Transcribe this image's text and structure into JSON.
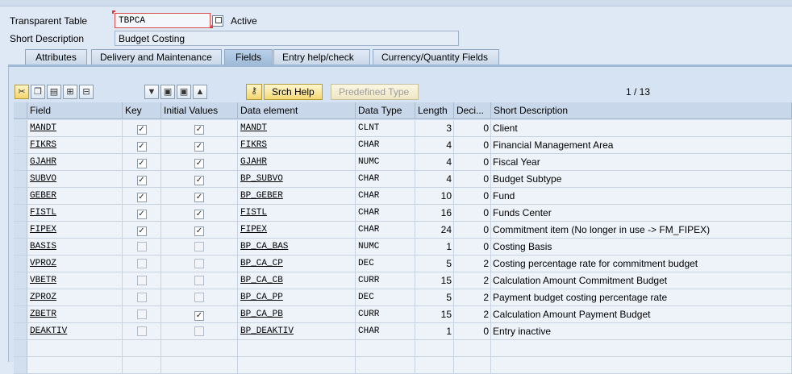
{
  "header": {
    "table_label": "Transparent Table",
    "table_name": "TBPCA",
    "status": "Active",
    "desc_label": "Short Description",
    "description": "Budget Costing"
  },
  "tabs": [
    {
      "label": "Attributes",
      "active": false
    },
    {
      "label": "Delivery and Maintenance",
      "active": false
    },
    {
      "label": "Fields",
      "active": true
    },
    {
      "label": "Entry help/check",
      "active": false
    },
    {
      "label": "Currency/Quantity Fields",
      "active": false
    }
  ],
  "toolbar": {
    "srch_help_label": "Srch Help",
    "predefined_type_label": "Predefined Type",
    "pager": "1 / 13"
  },
  "table": {
    "columns": [
      "Field",
      "Key",
      "Initial Values",
      "Data element",
      "Data Type",
      "Length",
      "Deci...",
      "Short Description"
    ],
    "rows": [
      {
        "field": "MANDT",
        "key": true,
        "initial": true,
        "element": "MANDT",
        "type": "CLNT",
        "length": "3",
        "decimals": "0",
        "desc": "Client"
      },
      {
        "field": "FIKRS",
        "key": true,
        "initial": true,
        "element": "FIKRS",
        "type": "CHAR",
        "length": "4",
        "decimals": "0",
        "desc": "Financial Management Area"
      },
      {
        "field": "GJAHR",
        "key": true,
        "initial": true,
        "element": "GJAHR",
        "type": "NUMC",
        "length": "4",
        "decimals": "0",
        "desc": "Fiscal Year"
      },
      {
        "field": "SUBVO",
        "key": true,
        "initial": true,
        "element": "BP_SUBVO",
        "type": "CHAR",
        "length": "4",
        "decimals": "0",
        "desc": "Budget Subtype"
      },
      {
        "field": "GEBER",
        "key": true,
        "initial": true,
        "element": "BP_GEBER",
        "type": "CHAR",
        "length": "10",
        "decimals": "0",
        "desc": "Fund"
      },
      {
        "field": "FISTL",
        "key": true,
        "initial": true,
        "element": "FISTL",
        "type": "CHAR",
        "length": "16",
        "decimals": "0",
        "desc": "Funds Center"
      },
      {
        "field": "FIPEX",
        "key": true,
        "initial": true,
        "element": "FIPEX",
        "type": "CHAR",
        "length": "24",
        "decimals": "0",
        "desc": "Commitment item (No longer in use -> FM_FIPEX)"
      },
      {
        "field": "BASIS",
        "key": false,
        "initial": false,
        "element": "BP_CA_BAS",
        "type": "NUMC",
        "length": "1",
        "decimals": "0",
        "desc": "Costing Basis"
      },
      {
        "field": "VPROZ",
        "key": false,
        "initial": false,
        "element": "BP_CA_CP",
        "type": "DEC",
        "length": "5",
        "decimals": "2",
        "desc": "Costing percentage rate for commitment budget"
      },
      {
        "field": "VBETR",
        "key": false,
        "initial": false,
        "element": "BP_CA_CB",
        "type": "CURR",
        "length": "15",
        "decimals": "2",
        "desc": "Calculation Amount Commitment Budget"
      },
      {
        "field": "ZPROZ",
        "key": false,
        "initial": false,
        "element": "BP_CA_PP",
        "type": "DEC",
        "length": "5",
        "decimals": "2",
        "desc": "Payment budget costing percentage rate"
      },
      {
        "field": "ZBETR",
        "key": false,
        "initial": true,
        "element": "BP_CA_PB",
        "type": "CURR",
        "length": "15",
        "decimals": "2",
        "desc": "Calculation Amount Payment Budget"
      },
      {
        "field": "DEAKTIV",
        "key": false,
        "initial": false,
        "element": "BP_DEAKTIV",
        "type": "CHAR",
        "length": "1",
        "decimals": "0",
        "desc": "Entry inactive"
      }
    ]
  }
}
